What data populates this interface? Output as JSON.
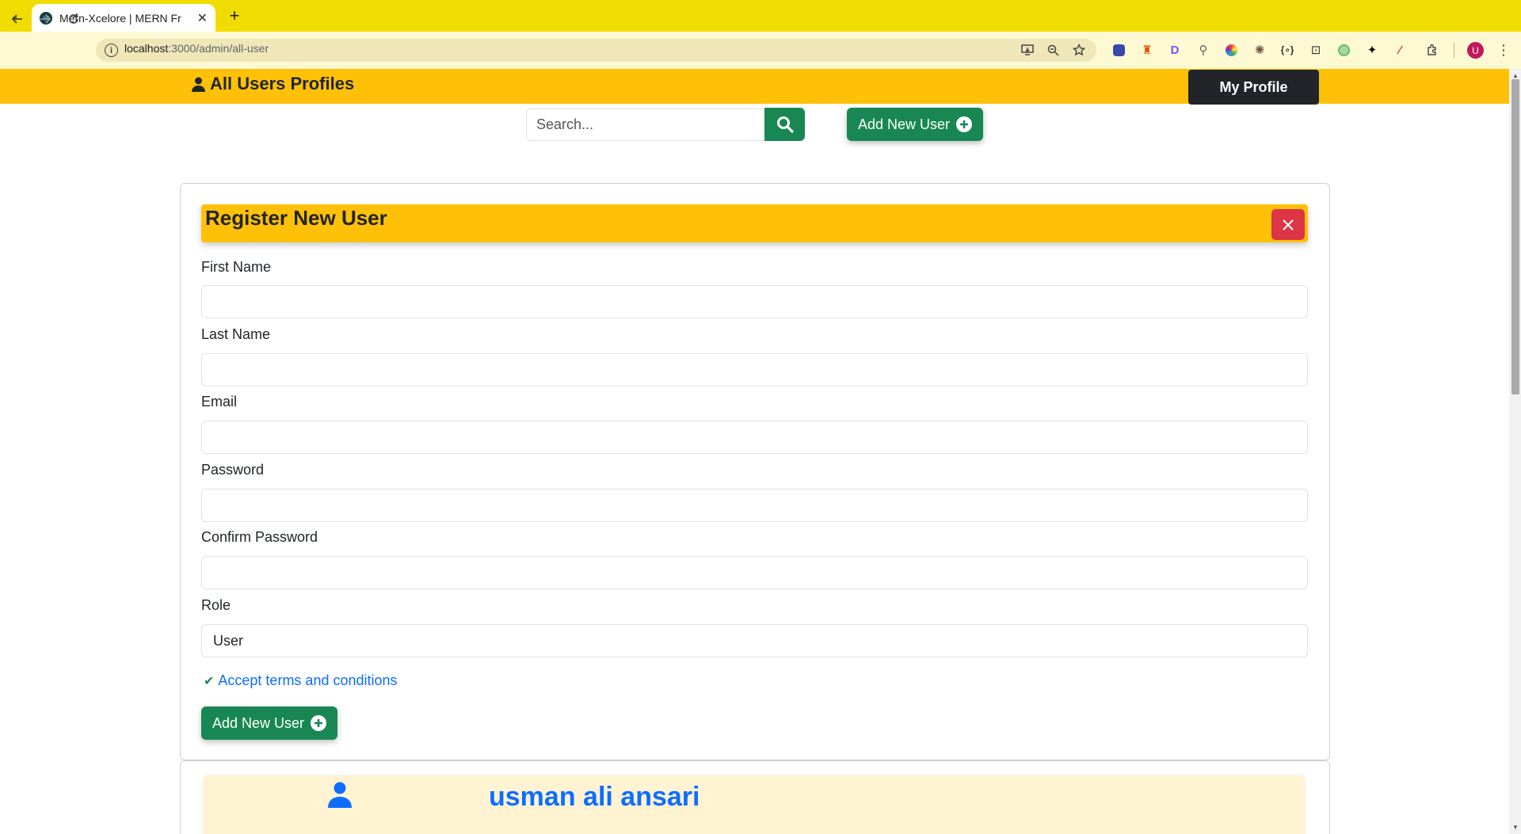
{
  "browser": {
    "tab_title": "Mern-Xcelore | MERN Fr",
    "tab_close_glyph": "✕",
    "new_tab_glyph": "+",
    "url_host": "localhost",
    "url_rest": ":3000/admin/all-user",
    "avatar_letter": "U"
  },
  "header": {
    "brand": "All Users Profiles",
    "my_profile": "My Profile"
  },
  "search": {
    "placeholder": "Search...",
    "value": ""
  },
  "top_actions": {
    "add_user": "Add New User"
  },
  "form": {
    "title": "Register New User",
    "fields": [
      {
        "label": "First Name",
        "value": ""
      },
      {
        "label": "Last Name",
        "value": ""
      },
      {
        "label": "Email",
        "value": ""
      },
      {
        "label": "Password",
        "value": ""
      },
      {
        "label": "Confirm Password",
        "value": ""
      }
    ],
    "role_label": "Role",
    "role_value": "User",
    "terms": "Accept terms and conditions",
    "submit": "Add New User"
  },
  "users": [
    {
      "name": "usman ali ansari"
    }
  ],
  "colors": {
    "tabstrip": "#f0dc00",
    "appbar": "#ffc107",
    "success": "#198754",
    "danger": "#dc3545",
    "primary": "#0d6efd",
    "dark": "#212529"
  }
}
